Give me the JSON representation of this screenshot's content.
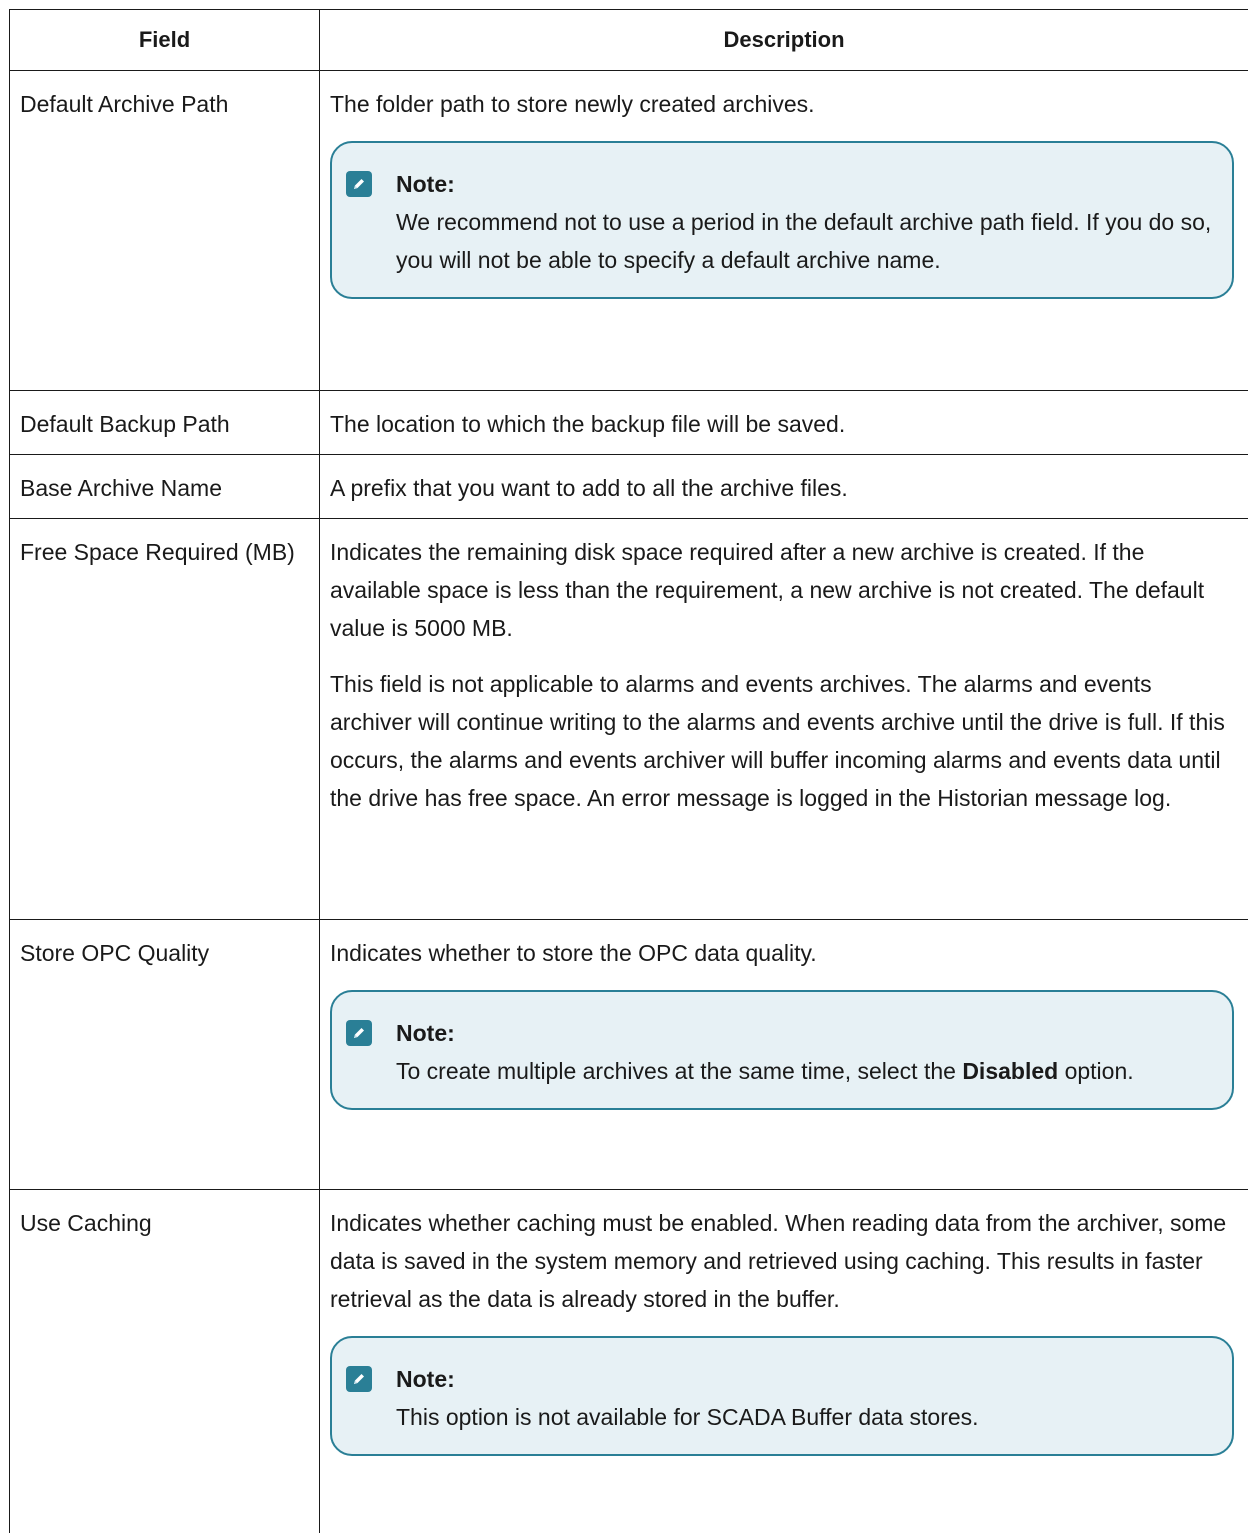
{
  "headers": {
    "field": "Field",
    "description": "Description"
  },
  "note_label": "Note:",
  "rows": [
    {
      "field": "Default Archive Path",
      "p1": "The folder path to store newly created archives.",
      "note": "We recommend not to use a period in the default archive path field. If you do so, you will not be able to specify a default archive name."
    },
    {
      "field": "Default Backup Path",
      "p1": "The location to which the backup file will be saved."
    },
    {
      "field": "Base Archive Name",
      "p1": "A prefix that you want to add to all the archive files."
    },
    {
      "field": "Free Space Required (MB)",
      "p1": "Indicates the remaining disk space required after a new archive is created. If the available space is less than the requirement, a new archive is not created. The default value is 5000 MB.",
      "p2": "This field is not applicable to alarms and events archives. The alarms and events archiver will continue writing to the alarms and events archive until the drive is full. If this occurs, the alarms and events archiver will buffer incoming alarms and events data until the drive has free space. An error message is logged in the Historian message log."
    },
    {
      "field": "Store OPC Quality",
      "p1": "Indicates whether to store the OPC data quality.",
      "note_before": "To create multiple archives at the same time, select the",
      "note_bold": "Disabled",
      "note_after": "option."
    },
    {
      "field": "Use Caching",
      "p1": "Indicates whether caching must be enabled. When reading data from the archiver, some data is saved in the system memory and retrieved using caching. This results in faster retrieval as the data is already stored in the buffer.",
      "note": "This option is not available for SCADA Buffer data stores."
    }
  ]
}
